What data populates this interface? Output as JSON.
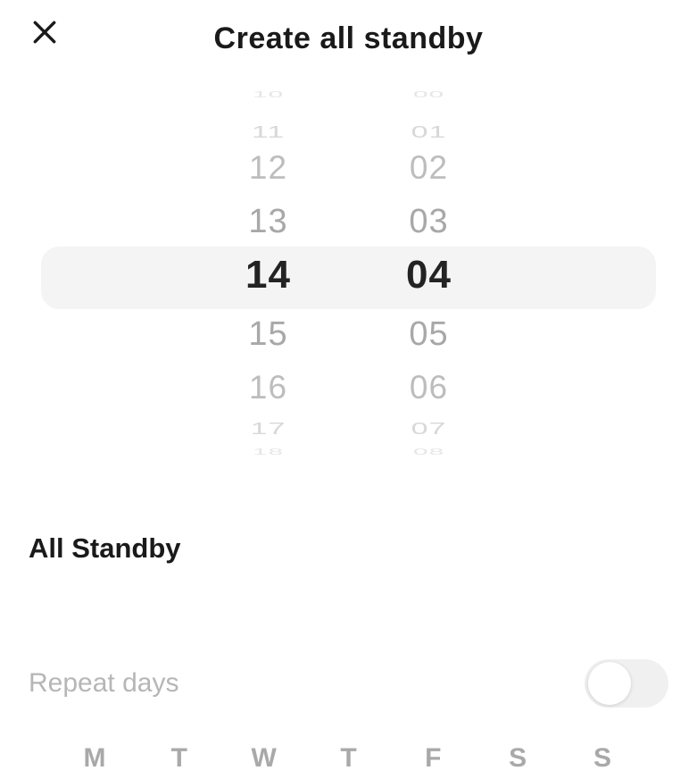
{
  "header": {
    "title": "Create all standby"
  },
  "time_picker": {
    "hour_column": {
      "values": [
        "10",
        "11",
        "12",
        "13",
        "14",
        "15",
        "16",
        "17",
        "18"
      ],
      "selected": "14"
    },
    "minute_column": {
      "values": [
        "00",
        "01",
        "02",
        "03",
        "04",
        "05",
        "06",
        "07",
        "08"
      ],
      "selected": "04"
    }
  },
  "section": {
    "label": "All Standby"
  },
  "repeat": {
    "label": "Repeat days",
    "enabled": false,
    "days": [
      "M",
      "T",
      "W",
      "T",
      "F",
      "S",
      "S"
    ]
  }
}
